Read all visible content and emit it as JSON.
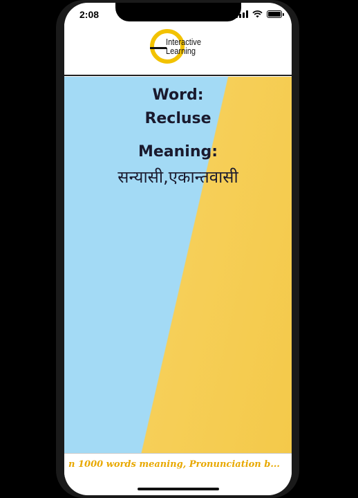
{
  "status_bar": {
    "time": "2:08",
    "icons": [
      "cellular-signal-icon",
      "wifi-icon",
      "battery-icon"
    ]
  },
  "header": {
    "logo_line1": "Interactive",
    "logo_line2": "Learning",
    "brand_color": "#f2c200"
  },
  "card": {
    "word_label": "Word:",
    "word": "Recluse",
    "meaning_label": "Meaning:",
    "meaning": "सन्यासी,एकान्तवासी",
    "colors": {
      "left": "#a3daf5",
      "right": "#f4c94a"
    }
  },
  "footer": {
    "marquee_text": "n 1000 words meaning, Pronunciation b..."
  }
}
